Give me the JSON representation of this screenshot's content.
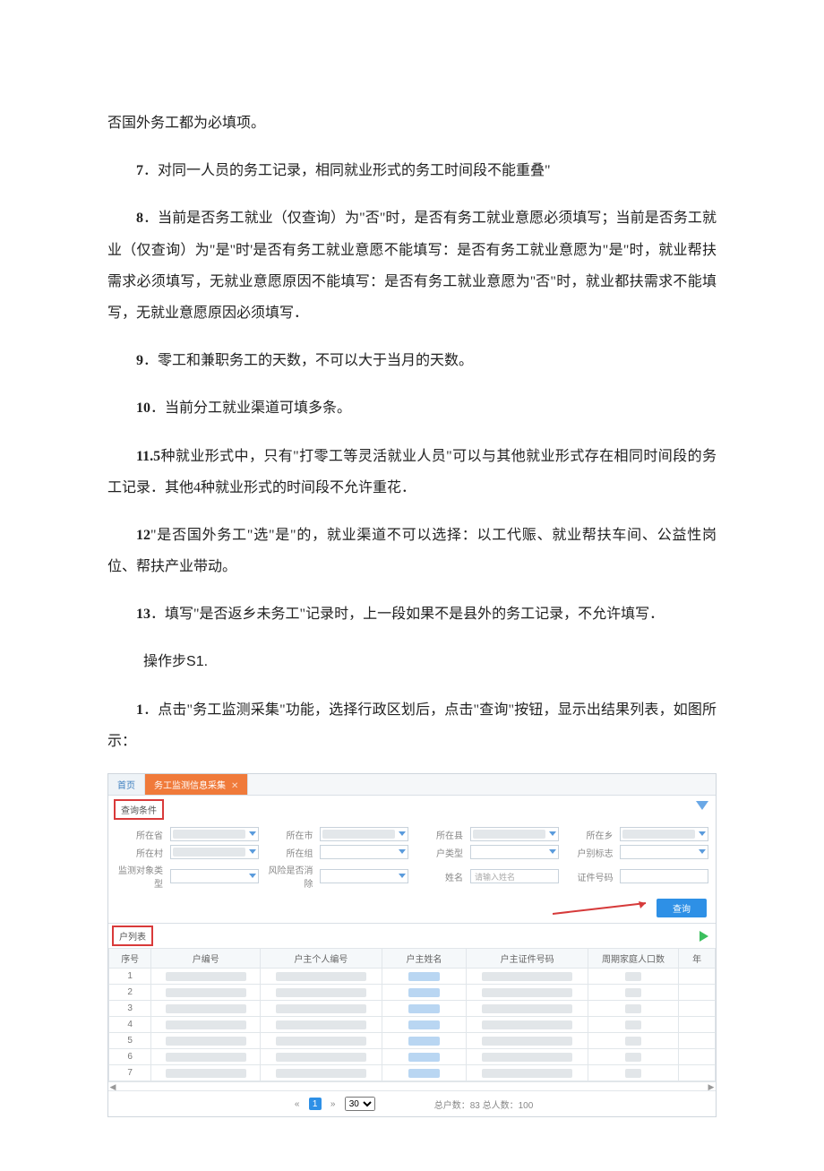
{
  "paras": {
    "p0": "否国外务工都为必填项。",
    "p7_num": "7",
    "p7": "．对同一人员的务工记录，相同就业形式的务工时间段不能重叠\"",
    "p8_num": "8",
    "p8": "．当前是否务工就业（仅查询）为\"否\"时，是否有务工就业意愿必须填写；当前是否务工就业（仅查询）为\"是''时'是否有务工就业意愿不能填写：是否有务工就业意愿为\"是\"时，就业帮扶需求必须填写，无就业意愿原因不能填写：是否有务工就业意愿为''否\"时，就业都扶需求不能填写，无就业意愿原因必须填写．",
    "p9_num": "9",
    "p9": "．零工和兼职务工的天数，不可以大于当月的天数。",
    "p10_num": "10",
    "p10": "．当前分工就业渠道可填多条。",
    "p11_num": "11.5",
    "p11": "种就业形式中，只有\"打零工等灵活就业人员\"可以与其他就业形式存在相同时间段的务工记录．其他4种就业形式的时间段不允许重花．",
    "p12_num": "12",
    "p12": "\"是否国外务工\"选\"是\"的，就业渠道不可以选择：以工代赈、就业帮扶车间、公益性岗位、帮扶产业带动。",
    "p13_num": "13",
    "p13": "．填写\"是否返乡未务工\"记录时，上一段如果不是县外的务工记录，不允许填写．",
    "step_title_a": "操作步",
    "step_title_b": "S1.",
    "s1_num": "1",
    "s1": "．点击\"务工监测采集\"功能，选择行政区划后，点击\"查询\"按钮，显示出结果列表，如图所示："
  },
  "figure": {
    "tabs": {
      "home": "首页",
      "active": "务工监测信息采集"
    },
    "panel_query": "查询条件",
    "filters": {
      "r1": [
        "所在省",
        "所在市",
        "所在县",
        "所在乡"
      ],
      "r2": [
        "所在村",
        "所在组",
        "户类型",
        "户别标志"
      ],
      "r3": [
        "监测对象类型",
        "风险是否消除",
        "姓名",
        "证件号码"
      ],
      "name_placeholder": "请输入姓名"
    },
    "search_btn": "查询",
    "list_tab": "户列表",
    "columns": [
      "序号",
      "户编号",
      "户主个人编号",
      "户主姓名",
      "户主证件号码",
      "周期家庭人口数",
      "年"
    ],
    "row_count": 7,
    "pager": {
      "current": "1",
      "per_page_options": [
        "30"
      ],
      "totals": "总户数：83  总人数：100"
    }
  }
}
